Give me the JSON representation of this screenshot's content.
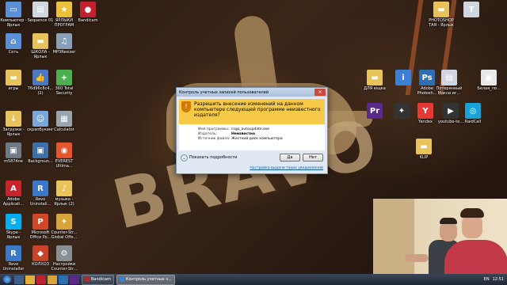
{
  "desktop": {
    "wallpaper_text": "BRAVO",
    "icons": [
      {
        "label": "Компьютер - Ярлык",
        "icon": "computer-icon",
        "color": "#5b8fd6"
      },
      {
        "label": "Sequence 01",
        "icon": "file-icon",
        "color": "#cfd6df"
      },
      {
        "label": "ЯРЛЫКИ ПРОГРАМ",
        "icon": "star-icon",
        "color": "#e9c23a"
      },
      {
        "label": "Bandicam",
        "icon": "bandicam-icon",
        "color": "#c0232e"
      },
      {
        "label": "Сеть",
        "icon": "network-icon",
        "color": "#5b8fd6"
      },
      {
        "label": "ШКОЛА - Ярлык",
        "icon": "folder-icon",
        "color": "#e8c25a"
      },
      {
        "label": "MP3Resizer",
        "icon": "app-icon",
        "color": "#8aa0b8"
      },
      {
        "label": "игры",
        "icon": "folder-icon",
        "color": "#e8c25a"
      },
      {
        "label": "76d96c8c4... (2)",
        "icon": "thumbs-up-icon",
        "color": "#4a78c4"
      },
      {
        "label": "360 Total Security",
        "icon": "shield-icon",
        "color": "#4caf50"
      },
      {
        "label": "Загрузки - Ярлык",
        "icon": "download-folder-icon",
        "color": "#e8c25a"
      },
      {
        "label": "скрапбукинг",
        "icon": "people-icon",
        "color": "#7aa6d8"
      },
      {
        "label": "Calculator",
        "icon": "calculator-icon",
        "color": "#9aa4ae"
      },
      {
        "label": "m5874ne",
        "icon": "image-icon",
        "color": "#6e7b86"
      },
      {
        "label": "Backgroun...",
        "icon": "image-icon",
        "color": "#3d6fa8"
      },
      {
        "label": "EVEREST Ultima...",
        "icon": "everest-icon",
        "color": "#e4572e"
      },
      {
        "label": "Adobe Applicati...",
        "icon": "adobe-icon",
        "color": "#c8242b"
      },
      {
        "label": "Revo Uninstall...",
        "icon": "revo-icon",
        "color": "#3a79c9"
      },
      {
        "label": "музыка - Ярлык (2)",
        "icon": "music-folder-icon",
        "color": "#e8c25a"
      },
      {
        "label": "Skype - Ярлык",
        "icon": "skype-icon",
        "color": "#00aff0"
      },
      {
        "label": "Microsoft Office Po...",
        "icon": "office-icon",
        "color": "#d24726"
      },
      {
        "label": "Counter-Str... Global Offe...",
        "icon": "csgo-icon",
        "color": "#d9a23a"
      },
      {
        "label": "Revo Uninstaller",
        "icon": "revo-icon",
        "color": "#3a79c9"
      },
      {
        "label": "КОЛХОЗ",
        "icon": "game-icon",
        "color": "#c8442b"
      },
      {
        "label": "Настройки Counter-Str...",
        "icon": "settings-icon",
        "color": "#8a8f96"
      },
      {
        "label": "PHOTOSHOP ТАЯ - Ярлык",
        "icon": "folder-icon",
        "color": "#e8c25a"
      },
      {
        "label": "",
        "icon": "text-icon",
        "color": "#cfd6df"
      },
      {
        "label": "ДЛЯ ющка",
        "icon": "folder-icon",
        "color": "#e8c25a"
      },
      {
        "label": "",
        "icon": "info-icon",
        "color": "#3b7fd6"
      },
      {
        "label": "Adobe Photosh...",
        "icon": "photoshop-icon",
        "color": "#2d6fb3"
      },
      {
        "label": "Потерянный Макси иг...",
        "icon": "document-icon",
        "color": "#cfd6df"
      },
      {
        "label": "Белая_по...",
        "icon": "image-icon",
        "color": "#e8e8e8"
      },
      {
        "label": "",
        "icon": "premiere-icon",
        "color": "#5a2a8a"
      },
      {
        "label": "",
        "icon": "csgo-icon",
        "color": "#333333"
      },
      {
        "label": "Yandex",
        "icon": "yandex-icon",
        "color": "#e53935"
      },
      {
        "label": "youtube-te...",
        "icon": "youtube-icon",
        "color": "#333333"
      },
      {
        "label": "RaidCall",
        "icon": "raidcall-icon",
        "color": "#1aa3d9"
      },
      {
        "label": "KLIP",
        "icon": "folder-icon",
        "color": "#e8c25a"
      }
    ]
  },
  "uac": {
    "title": "Контроль учетных записей пользователей",
    "question": "Разрешить внесение изменений на данном компьютере следующей программе неизвестного издателя?",
    "details": [
      {
        "key": "Имя программы:",
        "value": "csgo_autoupdate.exe",
        "bold": false
      },
      {
        "key": "Издатель:",
        "value": "Неизвестно",
        "bold": true
      },
      {
        "key": "Источник файла:",
        "value": "Жесткий диск компьютера",
        "bold": false
      }
    ],
    "show_details": "Показать подробности",
    "yes": "Да",
    "no": "Нет",
    "notify_link": "Настройка выдачи таких уведомлений",
    "accent_color": "#f7c948"
  },
  "taskbar": {
    "tasks": [
      {
        "label": "Bandicam",
        "active": false,
        "color": "#c0232e"
      },
      {
        "label": "Контроль учетных з...",
        "active": true,
        "color": "#3b7fd6"
      }
    ],
    "tray": {
      "language": "EN",
      "time": "12:51"
    }
  }
}
